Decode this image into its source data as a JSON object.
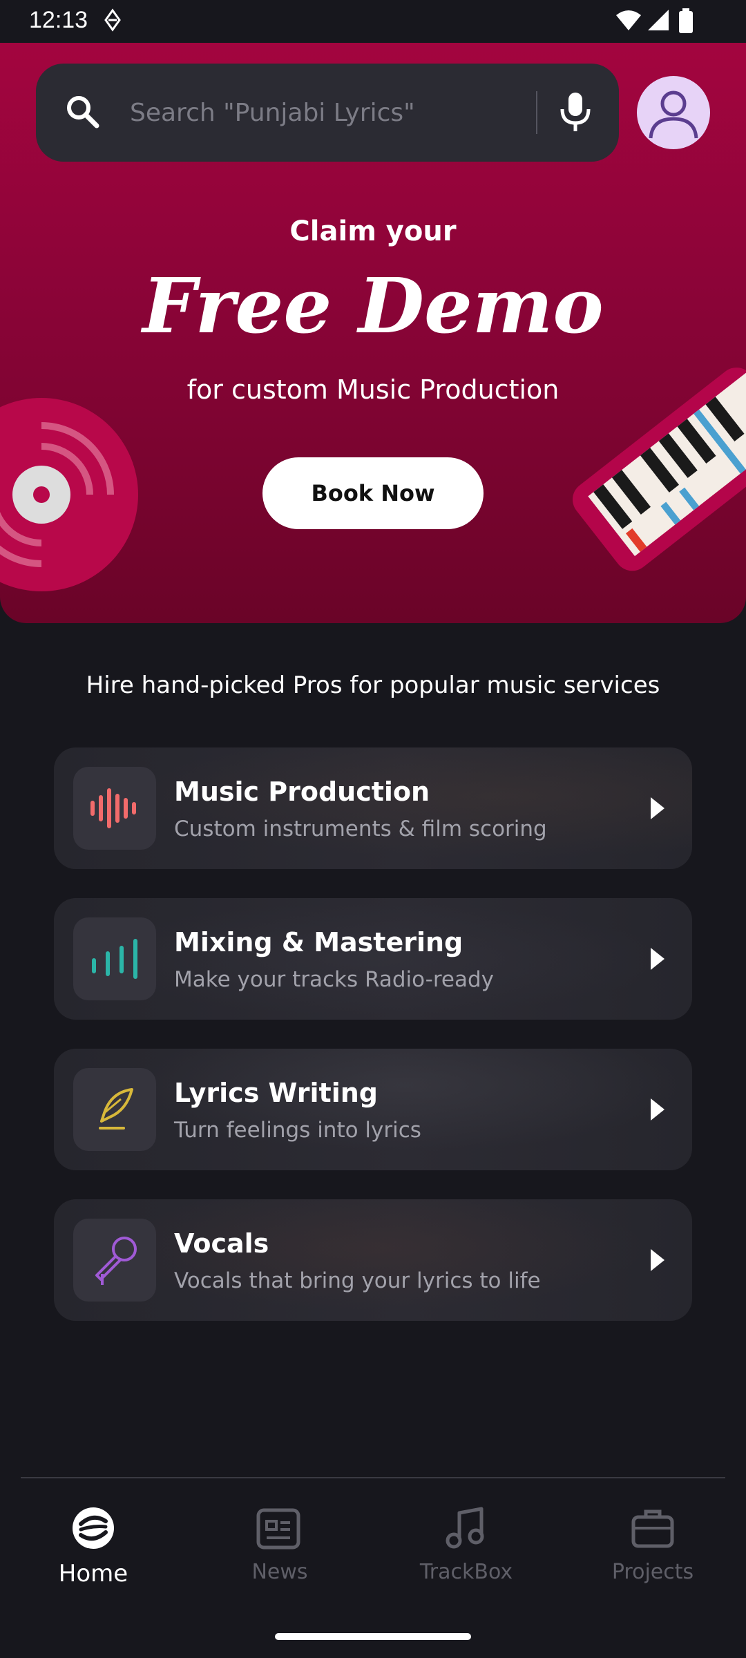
{
  "status_bar": {
    "time": "12:13"
  },
  "search": {
    "placeholder": "Search \"Punjabi Lyrics\""
  },
  "hero": {
    "claim_line": "Claim your",
    "headline": "Free Demo",
    "subline": "for custom Music Production",
    "cta_label": "Book Now"
  },
  "tagline": "Hire hand-picked Pros for popular music services",
  "services": [
    {
      "title": "Music Production",
      "subtitle": "Custom instruments & film scoring",
      "icon": "waveform-icon",
      "color": "#f26b6b"
    },
    {
      "title": "Mixing & Mastering",
      "subtitle": "Make your tracks Radio-ready",
      "icon": "equalizer-icon",
      "color": "#2bb5a8"
    },
    {
      "title": "Lyrics Writing",
      "subtitle": "Turn feelings into lyrics",
      "icon": "quill-icon",
      "color": "#d8b83a"
    },
    {
      "title": "Vocals",
      "subtitle": "Vocals that bring your lyrics to life",
      "icon": "microphone-icon",
      "color": "#a05ad6"
    }
  ],
  "nav": [
    {
      "label": "Home",
      "icon": "home-logo-icon",
      "active": true
    },
    {
      "label": "News",
      "icon": "news-icon",
      "active": false
    },
    {
      "label": "TrackBox",
      "icon": "music-note-icon",
      "active": false
    },
    {
      "label": "Projects",
      "icon": "briefcase-icon",
      "active": false
    }
  ],
  "colors": {
    "hero_top": "#a3053f",
    "hero_bottom": "#6a0428",
    "background": "#17171d",
    "card": "#2a2a31"
  }
}
